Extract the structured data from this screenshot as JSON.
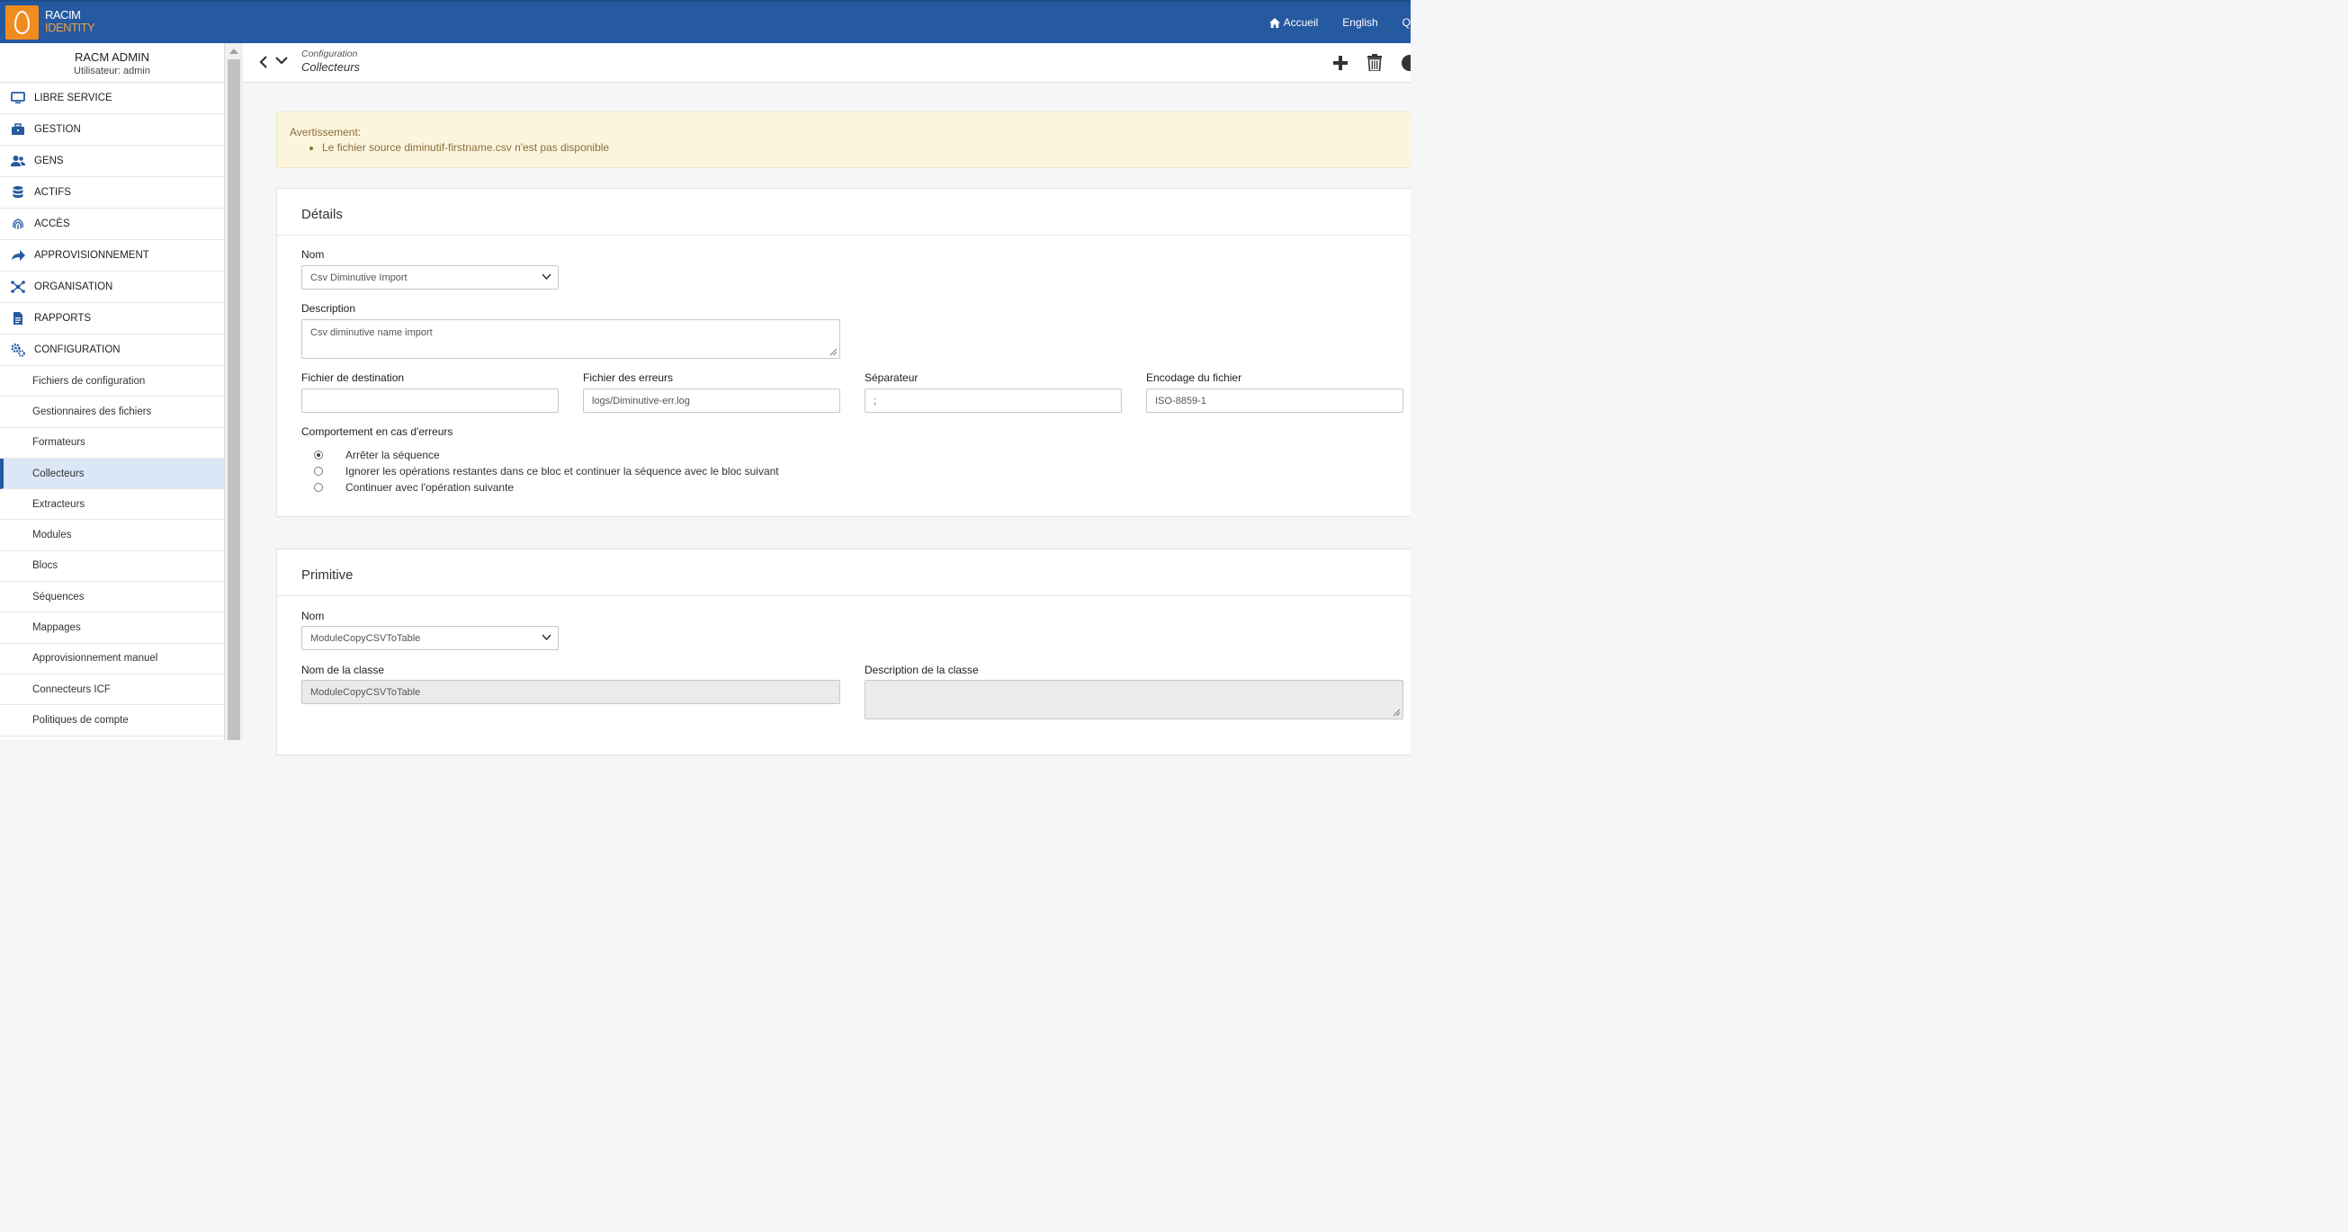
{
  "brand": {
    "line1": "RACIM",
    "line2": "IDENTITY"
  },
  "topnav": {
    "home": "Accueil",
    "language": "English",
    "more": "Q"
  },
  "user": {
    "name": "RACM ADMIN",
    "subtitle": "Utilisateur: admin"
  },
  "menu": [
    {
      "label": "LIBRE SERVICE",
      "icon": "monitor-icon"
    },
    {
      "label": "GESTION",
      "icon": "briefcase-icon"
    },
    {
      "label": "GENS",
      "icon": "users-icon"
    },
    {
      "label": "ACTIFS",
      "icon": "database-icon"
    },
    {
      "label": "ACCÈS",
      "icon": "fingerprint-icon"
    },
    {
      "label": "APPROVISIONNEMENT",
      "icon": "share-icon"
    },
    {
      "label": "ORGANISATION",
      "icon": "network-icon"
    },
    {
      "label": "RAPPORTS",
      "icon": "file-icon"
    },
    {
      "label": "CONFIGURATION",
      "icon": "cogs-icon"
    }
  ],
  "submenu": [
    "Fichiers de configuration",
    "Gestionnaires des fichiers",
    "Formateurs",
    "Collecteurs",
    "Extracteurs",
    "Modules",
    "Blocs",
    "Séquences",
    "Mappages",
    "Approvisionnement manuel",
    "Connecteurs ICF",
    "Politiques de compte"
  ],
  "active_submenu": "Collecteurs",
  "breadcrumb": {
    "parent": "Configuration",
    "current": "Collecteurs"
  },
  "warning": {
    "title": "Avertissement:",
    "message": "Le fichier source diminutif-firstname.csv n'est pas disponible"
  },
  "details": {
    "title": "Détails",
    "nom_label": "Nom",
    "nom_value": "Csv Diminutive Import",
    "description_label": "Description",
    "description_value": "Csv diminutive name import",
    "dest_label": "Fichier de destination",
    "dest_value": "",
    "err_label": "Fichier des erreurs",
    "err_value": "logs/Diminutive-err.log",
    "sep_label": "Séparateur",
    "sep_value": ";",
    "enc_label": "Encodage du fichier",
    "enc_value": "ISO-8859-1",
    "behavior_label": "Comportement en cas d'erreurs",
    "behavior_options": [
      "Arrêter la séquence",
      "Ignorer les opérations restantes dans ce bloc et continuer la séquence avec le bloc suivant",
      "Continuer avec l'opération suivante"
    ],
    "behavior_selected": 0
  },
  "primitive": {
    "title": "Primitive",
    "nom_label": "Nom",
    "nom_value": "ModuleCopyCSVToTable",
    "class_label": "Nom de la classe",
    "class_value": "ModuleCopyCSVToTable",
    "class_desc_label": "Description de la classe",
    "class_desc_value": ""
  },
  "colors": {
    "primary": "#2559a0",
    "logo": "#f08c1e",
    "warning_bg": "#fcf5de",
    "active_bg": "#dbe7f6"
  }
}
